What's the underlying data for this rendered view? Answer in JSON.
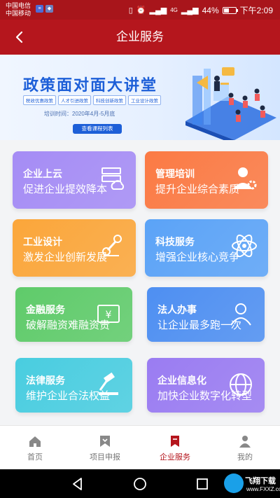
{
  "status_bar": {
    "carrier1": "中国电信",
    "carrier2": "中国移动",
    "battery": "44%",
    "battery_level": 0.44,
    "time": "下午2:09",
    "signal": "4G"
  },
  "header": {
    "title": "企业服务"
  },
  "banner": {
    "title": "政策面对面大讲堂",
    "tags": [
      "税收优惠政策",
      "人才引进政策",
      "科技创新政策",
      "工业设计政策"
    ],
    "date": "培训时间：2020年4月-5月底",
    "button": "查看课程列表"
  },
  "services": [
    {
      "title": "企业上云",
      "subtitle": "促进企业提效降本",
      "icon": "server-icon",
      "color": "#a58cf5"
    },
    {
      "title": "管理培训",
      "subtitle": "提升企业综合素质",
      "icon": "manager-gear-icon",
      "color": "#fb7a44"
    },
    {
      "title": "工业设计",
      "subtitle": "激发企业创新发展",
      "icon": "robot-arm-icon",
      "color": "#fba63a"
    },
    {
      "title": "科技服务",
      "subtitle": "增强企业核心竞争",
      "icon": "atom-icon",
      "color": "#5ba3f7"
    },
    {
      "title": "金融服务",
      "subtitle": "破解融资难融资贵",
      "icon": "money-icon",
      "color": "#5fcb6a"
    },
    {
      "title": "法人办事",
      "subtitle": "让企业最多跑一次",
      "icon": "person-icon",
      "color": "#4e8ff2"
    },
    {
      "title": "法律服务",
      "subtitle": "维护企业合法权益",
      "icon": "gavel-icon",
      "color": "#49cde0"
    },
    {
      "title": "企业信息化",
      "subtitle": "加快企业数字化转型",
      "icon": "globe-icon",
      "color": "#9a7cf2"
    }
  ],
  "nav": {
    "items": [
      {
        "label": "首页",
        "icon": "home-icon"
      },
      {
        "label": "项目申报",
        "icon": "bookmark-icon"
      },
      {
        "label": "企业服务",
        "icon": "service-bookmark-icon"
      },
      {
        "label": "我的",
        "icon": "profile-icon"
      }
    ],
    "active_color": "#b5161d"
  },
  "watermark": {
    "name": "飞翔下载",
    "url": "www.FXXZ.com"
  }
}
